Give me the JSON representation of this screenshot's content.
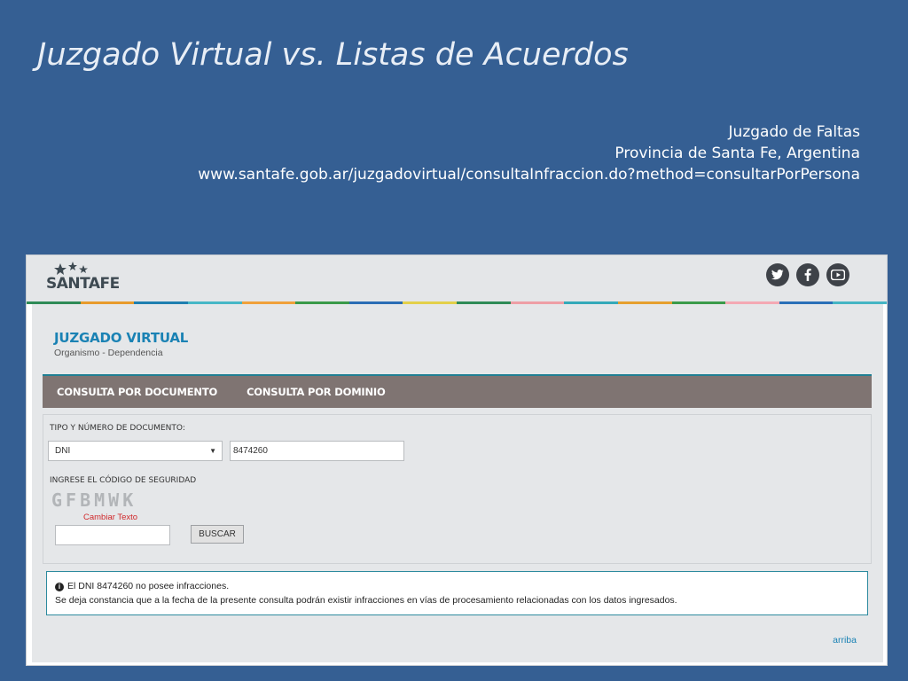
{
  "slide": {
    "title": "Juzgado Virtual vs. Listas de Acuerdos",
    "caption_lines": [
      "Juzgado de Faltas",
      "Provincia de Santa Fe, Argentina",
      "www.santafe.gob.ar/juzgadovirtual/consultaInfraccion.do?method=consultarPorPersona"
    ]
  },
  "site": {
    "logo": "SANTAFE",
    "social_icons": [
      "twitter-icon",
      "facebook-icon",
      "youtube-icon"
    ],
    "header_title": "JUZGADO VIRTUAL",
    "header_subtitle": "Organismo - Dependencia",
    "tabs": [
      {
        "label": "CONSULTA POR DOCUMENTO"
      },
      {
        "label": "CONSULTA POR DOMINIO"
      }
    ],
    "form": {
      "doc_label": "TIPO Y NÚMERO DE DOCUMENTO:",
      "doc_type": "DNI",
      "doc_number": "8474260",
      "security_label": "INGRESE EL CÓDIGO DE SEGURIDAD",
      "captcha_text": "GFBMWK",
      "change_text": "Cambiar Texto",
      "security_input": "",
      "search_button": "BUSCAR"
    },
    "result": {
      "line1": "El DNI 8474260 no posee infracciones.",
      "line2": "Se deja constancia que a la fecha de la presente consulta podrán existir infracciones en vías de procesamiento relacionadas con los datos ingresados."
    },
    "back_to_top": "arriba"
  },
  "colors": {
    "slide_bg": "#355f93",
    "accent_blue": "#1a82b4",
    "tab_bar": "#7f7472",
    "alert_border": "#2c8a9e"
  }
}
